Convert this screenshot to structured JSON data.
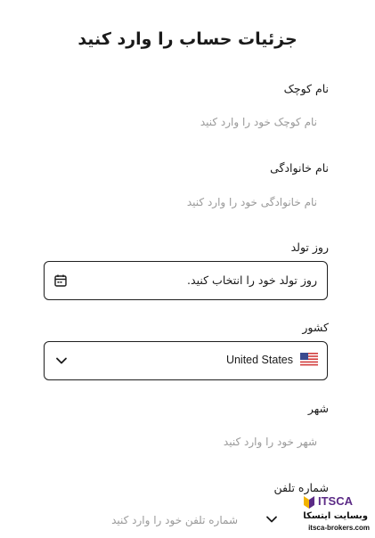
{
  "form": {
    "title": "جزئیات حساب را وارد کنید",
    "first_name": {
      "label": "نام کوچک",
      "placeholder": "نام کوچک خود را وارد کنید"
    },
    "last_name": {
      "label": "نام خانوادگی",
      "placeholder": "نام خانوادگی خود را وارد کنید"
    },
    "birthday": {
      "label": "روز تولد",
      "placeholder": "روز تولد خود را انتخاب کنید."
    },
    "country": {
      "label": "کشور",
      "value": "United States"
    },
    "city": {
      "label": "شهر",
      "placeholder": "شهر خود را وارد کنید"
    },
    "phone": {
      "label": "شماره تلفن",
      "placeholder": "شماره تلفن خود را وارد کنید"
    }
  },
  "watermark": {
    "brand": "ITSCA",
    "tagline": "وبسایت ایتسکا",
    "url": "itsca-brokers.com"
  },
  "colors": {
    "text": "#1a1a1a",
    "placeholder": "#9a9a9a",
    "border": "#1f1f1f",
    "watermark_accent": "#f2b300",
    "watermark_purple": "#5b2a86"
  }
}
